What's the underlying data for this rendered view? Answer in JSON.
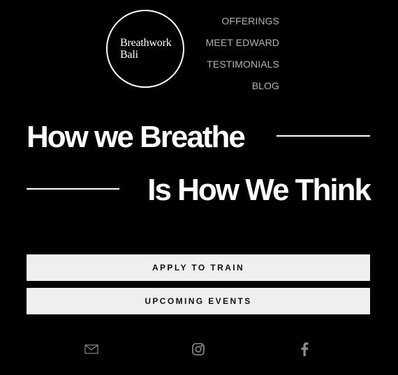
{
  "logo": {
    "line1": "Breathwork",
    "line2": "Bali"
  },
  "nav": {
    "items": [
      "OFFERINGS",
      "MEET EDWARD",
      "TESTIMONIALS",
      "BLOG"
    ]
  },
  "hero": {
    "line1": "How we Breathe",
    "line2": "Is How We Think"
  },
  "buttons": {
    "apply": "APPLY TO TRAIN",
    "events": "UPCOMING EVENTS"
  },
  "social": {
    "icons": [
      "mail-icon",
      "instagram-icon",
      "facebook-icon"
    ]
  },
  "colors": {
    "background": "#000000",
    "text": "#ffffff",
    "nav": "#b3b3b3",
    "button_bg": "#efefef",
    "button_text": "#111111",
    "icon": "#8c8c8c"
  }
}
